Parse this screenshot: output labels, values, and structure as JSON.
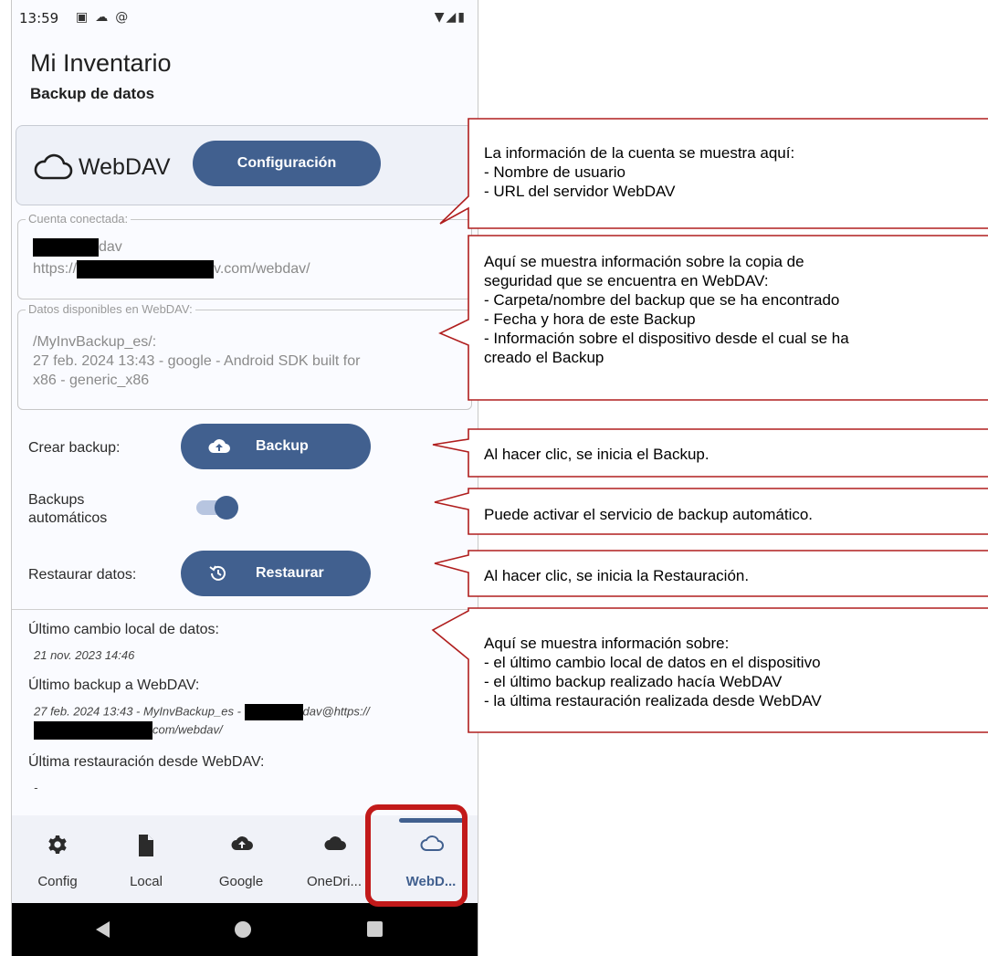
{
  "status_bar": {
    "time": "13:59",
    "left_icons": [
      "A-icon",
      "cloud-upload-icon",
      "at-icon"
    ],
    "right_icons": [
      "wifi-icon",
      "signal-icon",
      "battery-icon"
    ]
  },
  "app": {
    "title": "Mi Inventario",
    "subtitle": "Backup de datos"
  },
  "webdav": {
    "logo_text": "WebDAV",
    "config_button": "Configuración"
  },
  "account": {
    "legend": "Cuenta conectada:",
    "user_suffix": "dav",
    "url_prefix": "https://",
    "url_suffix": "v.com/webdav/"
  },
  "available": {
    "legend": "Datos disponibles en WebDAV:",
    "line1": "/MyInvBackup_es/:",
    "line2": "27 feb. 2024 13:43 - google - Android SDK built for",
    "line3": "x86 - generic_x86"
  },
  "actions": {
    "create_label": "Crear backup:",
    "backup_button": "Backup",
    "auto_label_1": "Backups",
    "auto_label_2": "automáticos",
    "auto_enabled": true,
    "restore_label": "Restaurar datos:",
    "restore_button": "Restaurar"
  },
  "info": {
    "last_local_label": "Último cambio local de datos:",
    "last_local_value": "21 nov. 2023 14:46",
    "last_backup_label": "Último backup a WebDAV:",
    "last_backup_value_a": "27 feb. 2024 13:43 - MyInvBackup_es - ",
    "last_backup_value_b": "dav@https://",
    "last_backup_value_c": "com/webdav/",
    "last_restore_label": "Última restauración desde WebDAV:",
    "last_restore_value": "-"
  },
  "bottom_nav": [
    {
      "label": "Config",
      "icon": "gear-icon"
    },
    {
      "label": "Local",
      "icon": "file-icon"
    },
    {
      "label": "Google",
      "icon": "cloud-upload-icon"
    },
    {
      "label": "OneDri...",
      "icon": "cloud-icon"
    },
    {
      "label": "WebD...",
      "icon": "cloud-outline-icon",
      "active": true
    }
  ],
  "callouts": [
    {
      "lines": [
        "La información de la cuenta se muestra aquí:",
        "- Nombre de usuario",
        "- URL del servidor WebDAV"
      ]
    },
    {
      "lines": [
        "Aquí se muestra información sobre la copia de",
        "seguridad que se encuentra en WebDAV:",
        "- Carpeta/nombre del backup que se ha encontrado",
        "- Fecha y hora de este Backup",
        "- Información sobre el dispositivo desde el cual se ha",
        "creado el Backup"
      ]
    },
    {
      "lines": [
        "Al hacer clic, se inicia el Backup."
      ]
    },
    {
      "lines": [
        "Puede activar el servicio de backup automático."
      ]
    },
    {
      "lines": [
        "Al hacer clic, se inicia la Restauración."
      ]
    },
    {
      "lines": [
        "Aquí se muestra información sobre:",
        "- el último cambio local de datos en el dispositivo",
        "- el último backup realizado hacía WebDAV",
        "- la última restauración realizada desde WebDAV"
      ]
    }
  ],
  "colors": {
    "primary": "#41608f",
    "callout_border": "#b01e1e",
    "highlight": "#c21a1a"
  }
}
